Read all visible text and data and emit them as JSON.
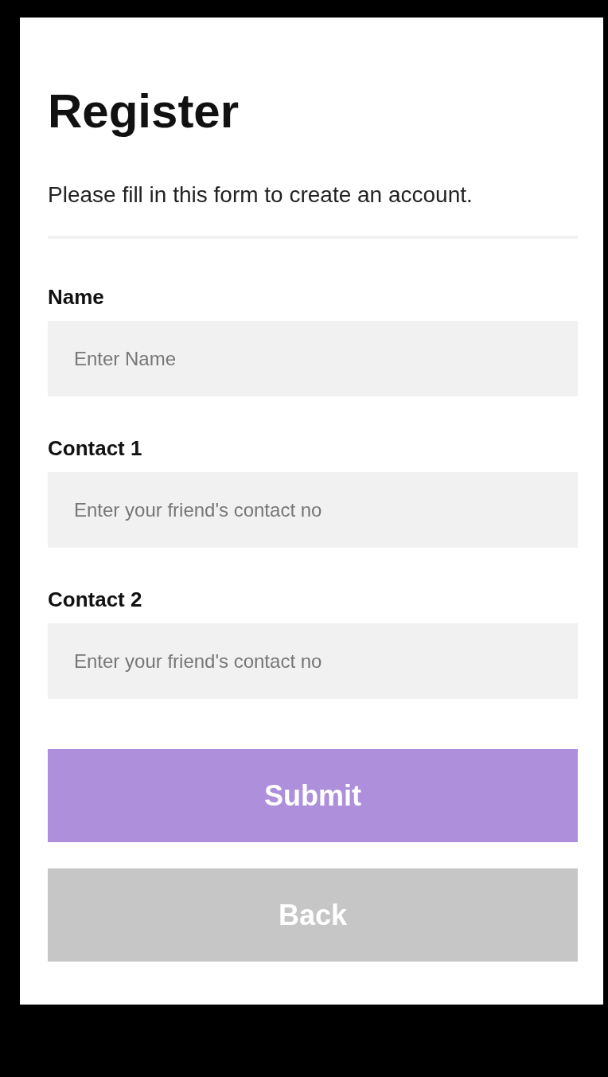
{
  "title": "Register",
  "subtitle": "Please fill in this form to create an account.",
  "fields": [
    {
      "label": "Name",
      "placeholder": "Enter Name"
    },
    {
      "label": "Contact 1",
      "placeholder": "Enter your friend's contact no"
    },
    {
      "label": "Contact 2",
      "placeholder": "Enter your friend's contact no"
    }
  ],
  "buttons": [
    {
      "label": "Submit",
      "color": "#ae8fdc"
    },
    {
      "label": "Back",
      "color": "#c6c6c6"
    }
  ]
}
